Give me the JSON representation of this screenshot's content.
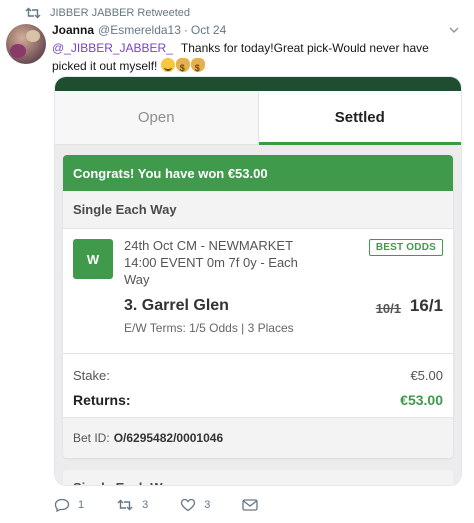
{
  "retweet": {
    "label": "JIBBER JABBER Retweeted"
  },
  "tweet": {
    "name": "Joanna",
    "handle": "@Esmerelda13",
    "separator": "·",
    "date": "Oct 24",
    "mention": "@_JIBBER_JABBER_",
    "text": "Thanks for today!Great pick-Would never have picked it out myself!"
  },
  "bet_slip": {
    "tabs": [
      {
        "label": "Open",
        "active": false
      },
      {
        "label": "Settled",
        "active": true
      }
    ],
    "win_message": "Congrats! You have won €53.00",
    "bet_type": "Single Each Way",
    "result_badge": "W",
    "event": "24th Oct CM - NEWMARKET 14:00 EVENT 0m 7f 0y - Each Way",
    "best_odds_label": "BEST ODDS",
    "selection": "3. Garrel Glen",
    "old_odds": "10/1",
    "new_odds": "16/1",
    "ew_terms": "E/W Terms: 1/5 Odds | 3 Places",
    "stake_label": "Stake:",
    "stake_value": "€5.00",
    "returns_label": "Returns:",
    "returns_value": "€53.00",
    "bet_id_label": "Bet ID:",
    "bet_id": "O/6295482/0001046",
    "next_bet_type": "Single Each Way"
  },
  "actions": {
    "reply_count": "1",
    "retweet_count": "3",
    "like_count": "3"
  },
  "colors": {
    "accent_green": "#3f9a4b",
    "header_dark_green": "#1e4d2f",
    "mention_purple": "#7b43c4",
    "muted_text": "#657786"
  }
}
